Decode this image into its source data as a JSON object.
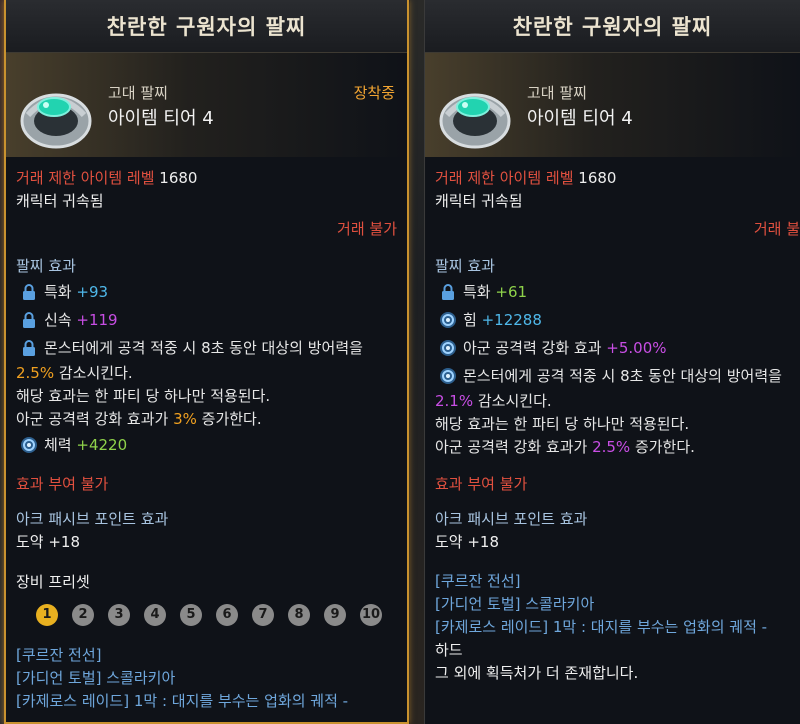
{
  "left": {
    "title": "찬란한 구원자의 팔찌",
    "item_type": "고대 팔찌",
    "tier": "아이템 티어 4",
    "equipped": "장착중",
    "trade_level_label": "거래 제한 아이템 레벨",
    "trade_level_value": "1680",
    "bound": "캐릭터 귀속됨",
    "no_trade": "거래 불가",
    "effects_header": "팔찌 효과",
    "stats": [
      {
        "icon": "lock-icon",
        "name": "특화",
        "value": "+93",
        "color": "cyan"
      },
      {
        "icon": "lock-icon",
        "name": "신속",
        "value": "+119",
        "color": "purple"
      }
    ],
    "special": {
      "icon": "lock-icon",
      "line1": "몬스터에게 공격 적중 시 8초 동안 대상의 방어력을",
      "pct": "2.5%",
      "line2_rest": " 감소시킨다.",
      "line3": "해당 효과는 한 파티 당 하나만 적용된다.",
      "line4_pre": "아군 공격력 강화 효과가 ",
      "line4_pct": "3%",
      "line4_post": " 증가한다."
    },
    "vitality": {
      "icon": "swirl-icon",
      "name": "체력",
      "value": "+4220"
    },
    "no_enchant": "효과 부여 불가",
    "ark_header": "아크 패시브 포인트 효과",
    "ark_value": "도약 +18",
    "preset_header": "장비 프리셋",
    "presets": [
      "1",
      "2",
      "3",
      "4",
      "5",
      "6",
      "7",
      "8",
      "9",
      "10"
    ],
    "sources": [
      "[쿠르잔 전선]",
      "[가디언 토벌] 스콜라키아",
      "[카제로스 레이드] 1막 : 대지를 부수는 업화의 궤적 -"
    ]
  },
  "right": {
    "title": "찬란한 구원자의 팔찌",
    "item_type": "고대 팔찌",
    "tier": "아이템 티어 4",
    "trade_level_label": "거래 제한 아이템 레벨",
    "trade_level_value": "1680",
    "bound": "캐릭터 귀속됨",
    "no_trade": "거래 불",
    "effects_header": "팔찌 효과",
    "stats": [
      {
        "icon": "lock-icon",
        "name": "특화",
        "value": "+61",
        "color": "green"
      },
      {
        "icon": "swirl-icon",
        "name": "힘",
        "value": "+12288",
        "color": "cyan"
      },
      {
        "icon": "swirl-icon",
        "name": "아군 공격력 강화 효과",
        "value": "+5.00%",
        "color": "purple"
      }
    ],
    "special": {
      "icon": "swirl-icon",
      "line1": "몬스터에게 공격 적중 시 8초 동안 대상의 방어력을",
      "pct": "2.1%",
      "line2_rest": " 감소시킨다.",
      "line3": "해당 효과는 한 파티 당 하나만 적용된다.",
      "line4_pre": "아군 공격력 강화 효과가 ",
      "line4_pct": "2.5%",
      "line4_post": " 증가한다."
    },
    "no_enchant": "효과 부여 불가",
    "ark_header": "아크 패시브 포인트 효과",
    "ark_value": "도약 +18",
    "sources": [
      "[쿠르잔 전선]",
      "[가디언 토벌] 스콜라키아",
      "[카제로스 레이드] 1막 : 대지를 부수는 업화의 궤적 -",
      "하드",
      "그 외에 획득처가 더 존재합니다."
    ]
  },
  "colors": {
    "accent": "#c9922f",
    "red": "#e0503f",
    "cyan": "#4fb8ea",
    "purple": "#c84ee4",
    "green": "#8fd34a",
    "orange": "#f0a020"
  }
}
